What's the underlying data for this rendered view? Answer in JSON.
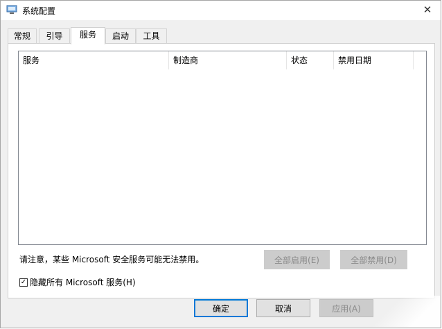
{
  "window": {
    "title": "系统配置",
    "close_glyph": "✕"
  },
  "tabs": [
    {
      "label": "常规",
      "active": false
    },
    {
      "label": "引导",
      "active": false
    },
    {
      "label": "服务",
      "active": true
    },
    {
      "label": "启动",
      "active": false
    },
    {
      "label": "工具",
      "active": false
    }
  ],
  "services_list": {
    "columns": [
      "服务",
      "制造商",
      "状态",
      "禁用日期"
    ],
    "rows": []
  },
  "notice": "请注意，某些 Microsoft 安全服务可能无法禁用。",
  "buttons": {
    "enable_all": "全部启用(E)",
    "disable_all": "全部禁用(D)"
  },
  "hide_ms": {
    "label": "隐藏所有 Microsoft 服务(H)",
    "checked": true,
    "check_glyph": "✓"
  },
  "dialog_buttons": {
    "ok": "确定",
    "cancel": "取消",
    "apply": "应用(A)"
  },
  "colors": {
    "accent": "#0078d7",
    "panel": "#f0f0f0",
    "disabled_button": "#cccccc"
  }
}
